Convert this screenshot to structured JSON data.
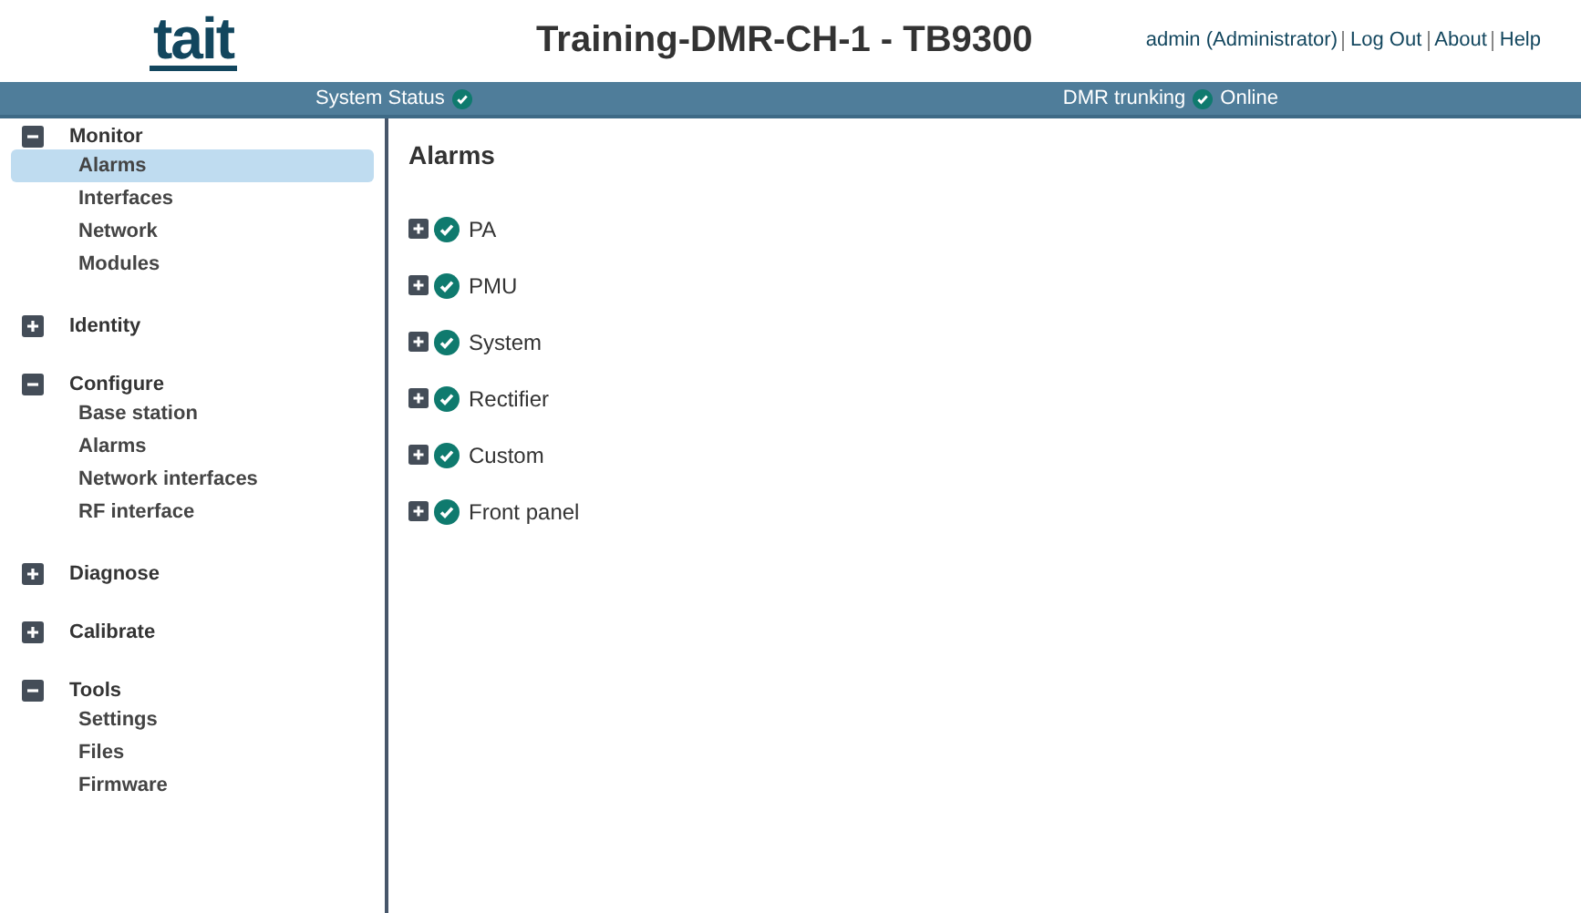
{
  "header": {
    "logo": "tait",
    "title": "Training-DMR-CH-1 - TB9300",
    "user": "admin (Administrator)",
    "links": [
      "Log Out",
      "About",
      "Help"
    ]
  },
  "status_bar": {
    "system_label": "System Status",
    "system_ok": true,
    "mode_label": "DMR trunking",
    "mode_ok": true,
    "mode_state": "Online"
  },
  "sidebar": {
    "groups": [
      {
        "label": "Monitor",
        "expanded": true,
        "items": [
          {
            "label": "Alarms",
            "selected": true
          },
          {
            "label": "Interfaces",
            "selected": false
          },
          {
            "label": "Network",
            "selected": false
          },
          {
            "label": "Modules",
            "selected": false
          }
        ]
      },
      {
        "label": "Identity",
        "expanded": false
      },
      {
        "label": "Configure",
        "expanded": true,
        "items": [
          {
            "label": "Base station",
            "selected": false
          },
          {
            "label": "Alarms",
            "selected": false
          },
          {
            "label": "Network interfaces",
            "selected": false
          },
          {
            "label": "RF interface",
            "selected": false
          }
        ]
      },
      {
        "label": "Diagnose",
        "expanded": false
      },
      {
        "label": "Calibrate",
        "expanded": false
      },
      {
        "label": "Tools",
        "expanded": true,
        "items": [
          {
            "label": "Settings",
            "selected": false
          },
          {
            "label": "Files",
            "selected": false
          },
          {
            "label": "Firmware",
            "selected": false
          }
        ]
      }
    ]
  },
  "content": {
    "heading": "Alarms",
    "alarms": [
      {
        "label": "PA",
        "expanded": false,
        "ok": true
      },
      {
        "label": "PMU",
        "expanded": false,
        "ok": true
      },
      {
        "label": "System",
        "expanded": false,
        "ok": true
      },
      {
        "label": "Rectifier",
        "expanded": false,
        "ok": true
      },
      {
        "label": "Custom",
        "expanded": false,
        "ok": true
      },
      {
        "label": "Front panel",
        "expanded": false,
        "ok": true
      }
    ]
  }
}
